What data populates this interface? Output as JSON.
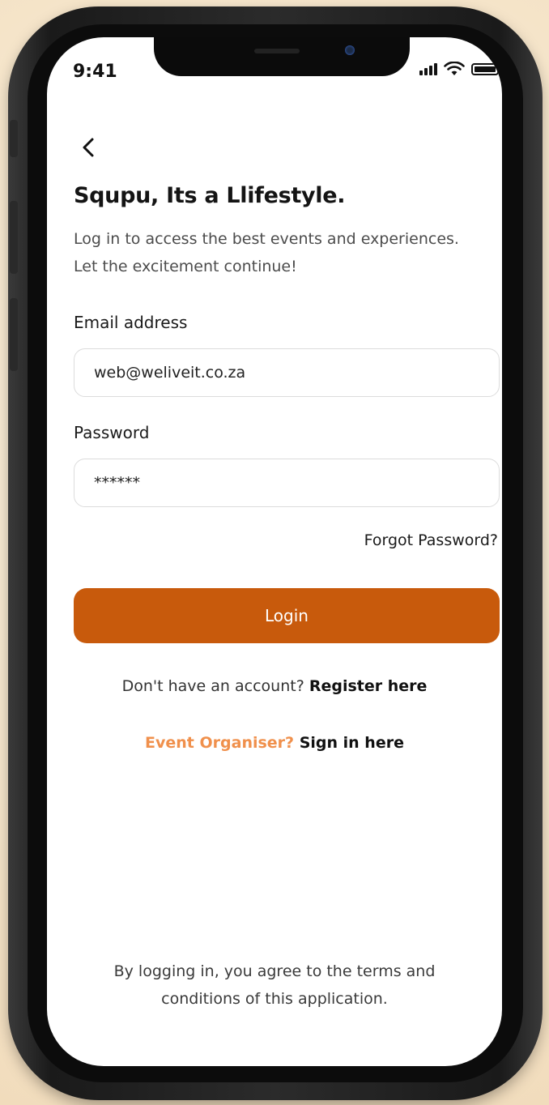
{
  "status_bar": {
    "time": "9:41"
  },
  "header": {
    "title": "Squpu, Its a Llifestyle.",
    "subtitle": "Log in to access the best events and experiences. Let the excitement continue!"
  },
  "form": {
    "email_label": "Email address",
    "email_value": "web@weliveit.co.za",
    "password_label": "Password",
    "password_value": "******",
    "forgot_label": "Forgot Password?",
    "login_label": "Login"
  },
  "register": {
    "prompt": "Don't have an account?",
    "link": "Register here"
  },
  "organiser": {
    "prompt": "Event Organiser?",
    "link": "Sign in here"
  },
  "footer": {
    "terms": "By logging in, you agree to the terms and conditions of this application."
  },
  "colors": {
    "accent": "#c85a0c",
    "organiser_accent": "#f0904c"
  },
  "icons": [
    "back-chevron-icon",
    "cellular-signal-icon",
    "wifi-icon",
    "battery-icon"
  ]
}
